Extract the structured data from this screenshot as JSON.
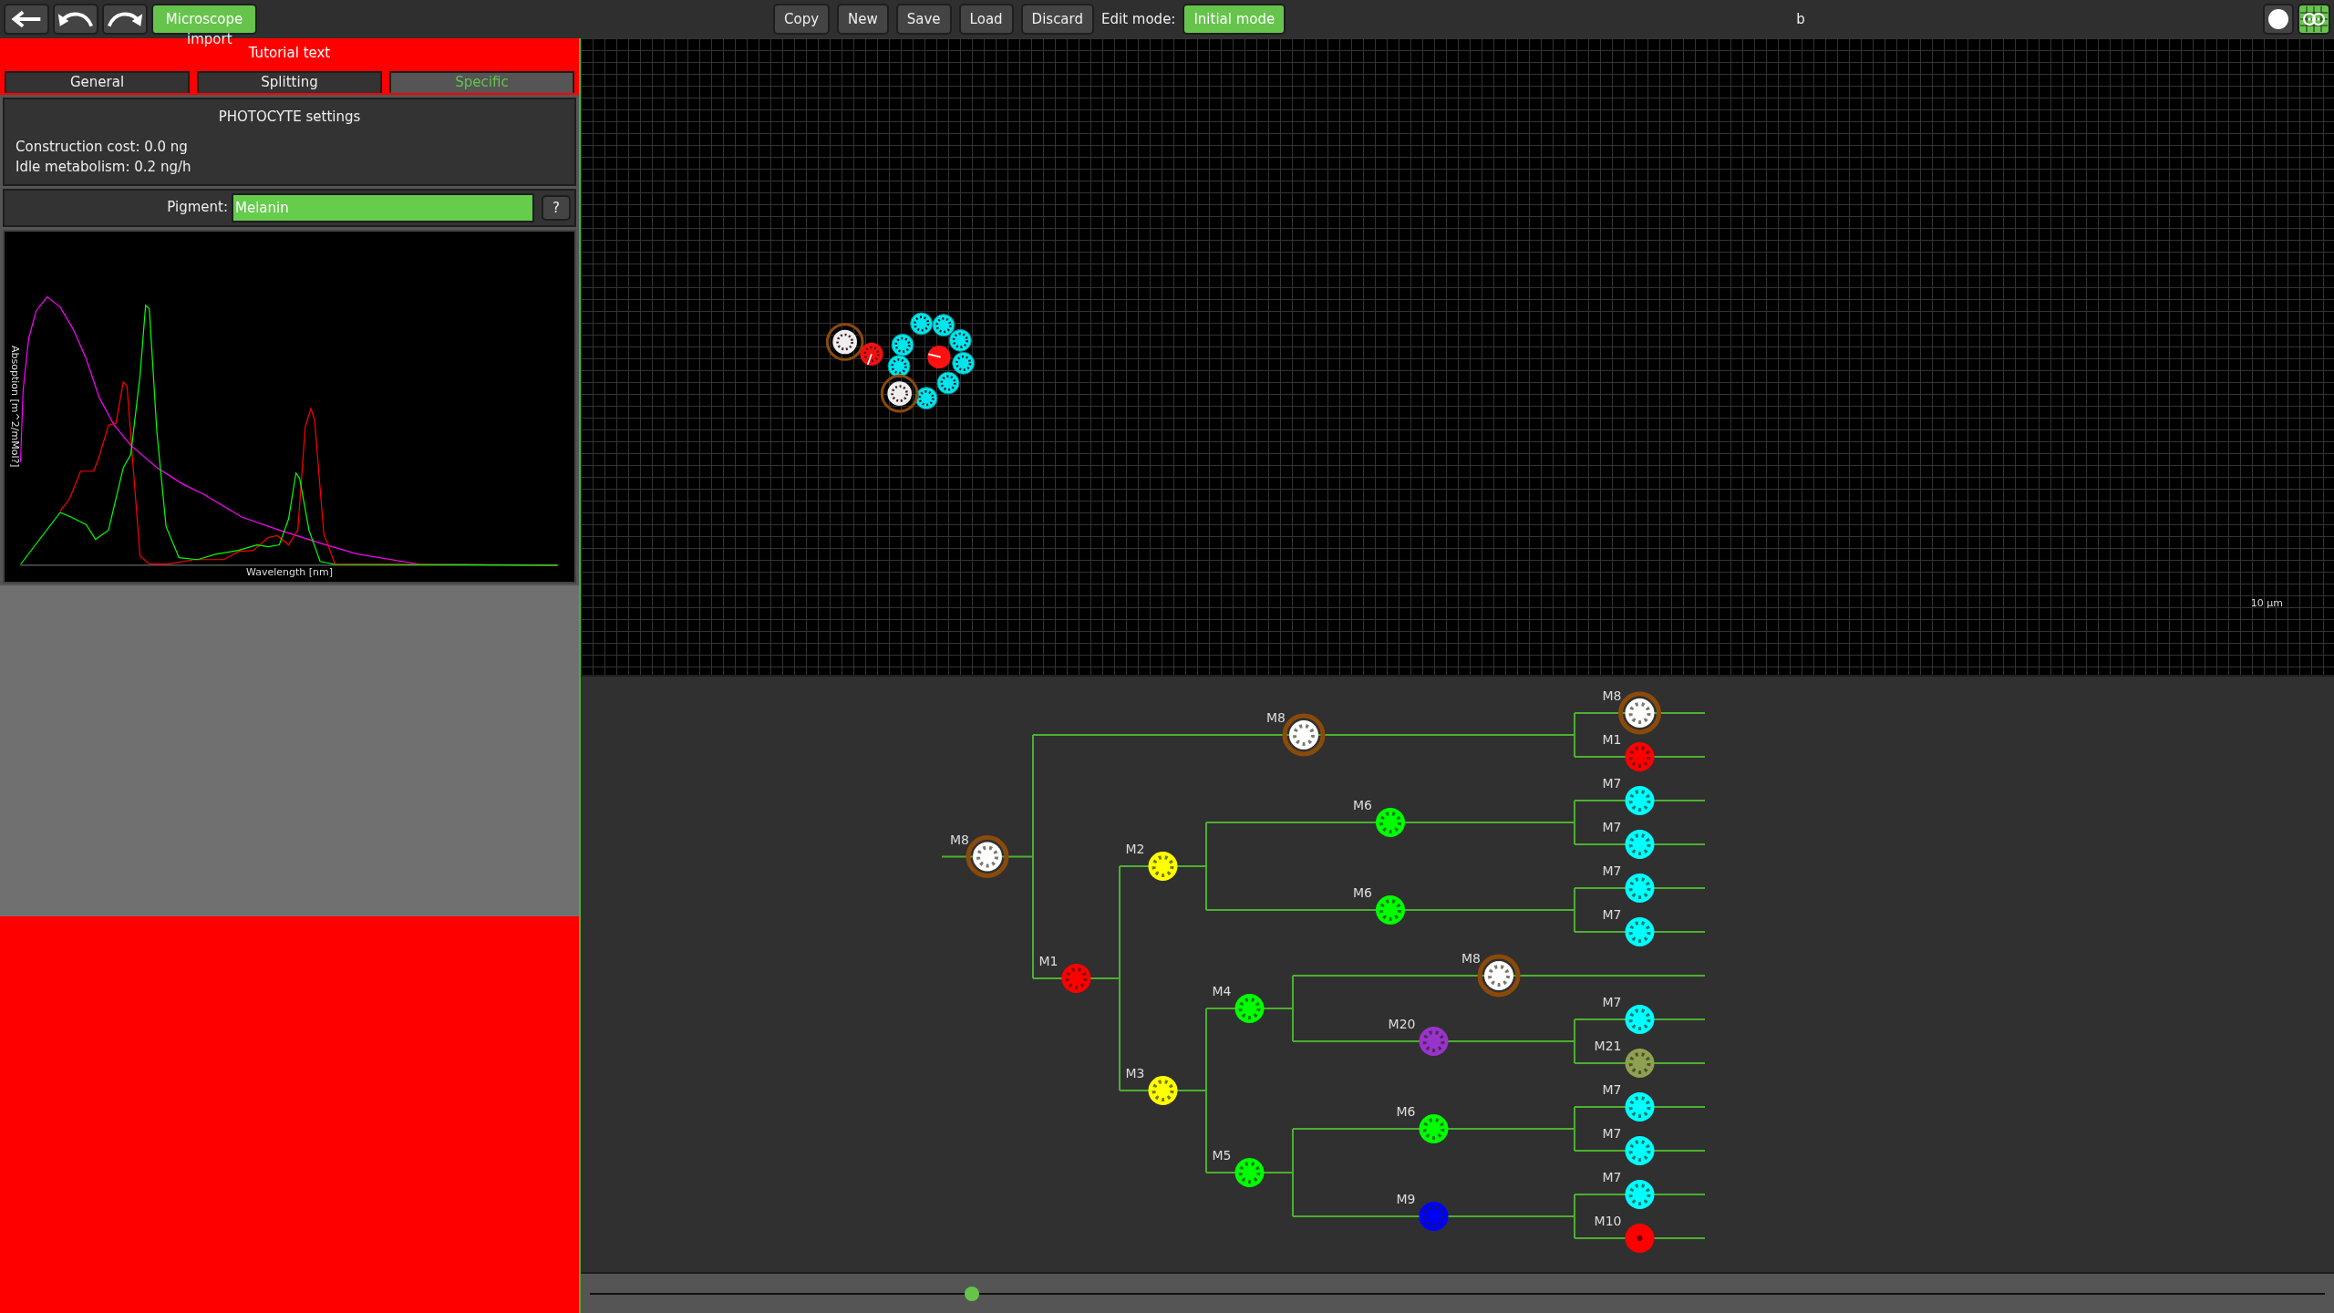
{
  "toolbar": {
    "microscope_button": "Microscope",
    "import_label": "import",
    "actions": [
      "Copy",
      "New",
      "Save",
      "Load",
      "Discard"
    ],
    "edit_mode_label": "Edit mode:",
    "edit_mode": "Initial mode",
    "status_text": "b"
  },
  "tutorial_text": "Tutorial text",
  "tabs": [
    {
      "label": "General",
      "selected": false
    },
    {
      "label": "Splitting",
      "selected": false
    },
    {
      "label": "Specific",
      "selected": true
    }
  ],
  "settings": {
    "title": "PHOTOCYTE settings",
    "lines": [
      "Construction cost: 0.0 ng",
      "Idle metabolism: 0.2 ng/h"
    ]
  },
  "pigment": {
    "label": "Pigment:",
    "value": "Melanin",
    "help": "?"
  },
  "spectrum": {
    "ylabel": "Absoption [m^2/mMol?]",
    "xlabel": "Wavelength [nm]"
  },
  "scale_label": "10 µm",
  "lineage_tree": {
    "label": "M8",
    "color": "#ffffff",
    "ringed": true,
    "kind": "textured",
    "children": [
      {
        "label": "M8",
        "color": "#ffffff",
        "ringed": true,
        "kind": "textured",
        "children": [
          {
            "label": "M8",
            "color": "#ffffff",
            "ringed": true,
            "kind": "textured"
          },
          {
            "label": "M1",
            "color": "#ff0000",
            "ringed": false,
            "kind": "textured"
          }
        ]
      },
      {
        "label": "M1",
        "color": "#ff0000",
        "ringed": false,
        "kind": "textured",
        "children": [
          {
            "label": "M2",
            "color": "#ffff00",
            "ringed": false,
            "kind": "textured",
            "children": [
              {
                "label": "M6",
                "color": "#00ff00",
                "ringed": false,
                "kind": "textured",
                "children": [
                  {
                    "label": "M7",
                    "color": "#00ffff",
                    "ringed": false,
                    "kind": "textured"
                  },
                  {
                    "label": "M7",
                    "color": "#00ffff",
                    "ringed": false,
                    "kind": "textured"
                  }
                ]
              },
              {
                "label": "M6",
                "color": "#00ff00",
                "ringed": false,
                "kind": "textured",
                "children": [
                  {
                    "label": "M7",
                    "color": "#00ffff",
                    "ringed": false,
                    "kind": "textured"
                  },
                  {
                    "label": "M7",
                    "color": "#00ffff",
                    "ringed": false,
                    "kind": "textured"
                  }
                ]
              }
            ]
          },
          {
            "label": "M3",
            "color": "#ffff00",
            "ringed": false,
            "kind": "textured",
            "children": [
              {
                "label": "M4",
                "color": "#00ff00",
                "ringed": false,
                "kind": "textured",
                "children": [
                  {
                    "label": "M8",
                    "color": "#ffffff",
                    "ringed": true,
                    "kind": "textured"
                  },
                  {
                    "label": "M20",
                    "color": "#9933cc",
                    "ringed": false,
                    "kind": "textured",
                    "children": [
                      {
                        "label": "M7",
                        "color": "#00ffff",
                        "ringed": false,
                        "kind": "textured"
                      },
                      {
                        "label": "M21",
                        "color": "#8fa050",
                        "ringed": false,
                        "kind": "textured"
                      }
                    ]
                  }
                ]
              },
              {
                "label": "M5",
                "color": "#00ff00",
                "ringed": false,
                "kind": "textured",
                "children": [
                  {
                    "label": "M6",
                    "color": "#00ff00",
                    "ringed": false,
                    "kind": "textured",
                    "children": [
                      {
                        "label": "M7",
                        "color": "#00ffff",
                        "ringed": false,
                        "kind": "textured"
                      },
                      {
                        "label": "M7",
                        "color": "#00ffff",
                        "ringed": false,
                        "kind": "textured"
                      }
                    ]
                  },
                  {
                    "label": "M9",
                    "color": "#0000ff",
                    "ringed": false,
                    "kind": "textured",
                    "children": [
                      {
                        "label": "M7",
                        "color": "#00ffff",
                        "ringed": false,
                        "kind": "textured"
                      },
                      {
                        "label": "M10",
                        "color": "#ff0000",
                        "ringed": false,
                        "kind": "plain"
                      }
                    ]
                  }
                ]
              }
            ]
          }
        ]
      }
    ]
  },
  "timeline": {
    "level": 0.22
  }
}
